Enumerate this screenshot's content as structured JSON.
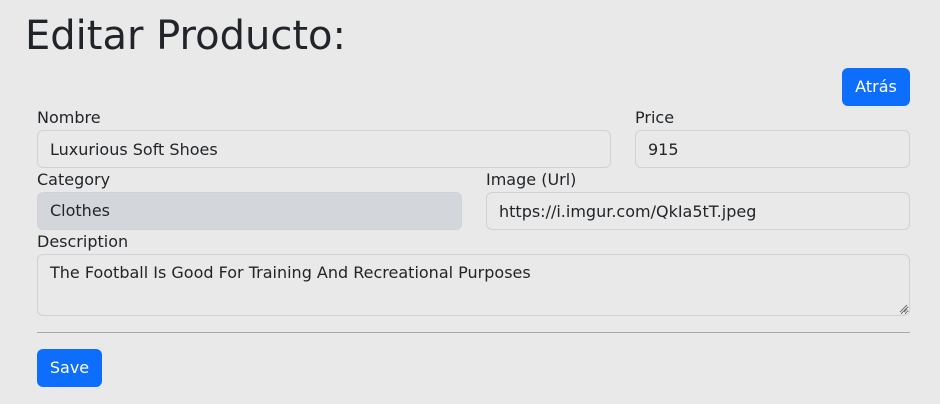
{
  "page": {
    "title": "Editar Producto:"
  },
  "toolbar": {
    "back_label": "Atrás"
  },
  "form": {
    "name": {
      "label": "Nombre",
      "value": "Luxurious Soft Shoes"
    },
    "price": {
      "label": "Price",
      "value": "915"
    },
    "category": {
      "label": "Category",
      "value": "Clothes"
    },
    "image": {
      "label": "Image (Url)",
      "value": "https://i.imgur.com/QkIa5tT.jpeg"
    },
    "description": {
      "label": "Description",
      "value": "The Football Is Good For Training And Recreational Purposes"
    },
    "save_label": "Save"
  },
  "colors": {
    "primary": "#0d6efd",
    "background": "#e9e9e9",
    "disabled_field": "#d3d6da",
    "text": "#212529"
  }
}
